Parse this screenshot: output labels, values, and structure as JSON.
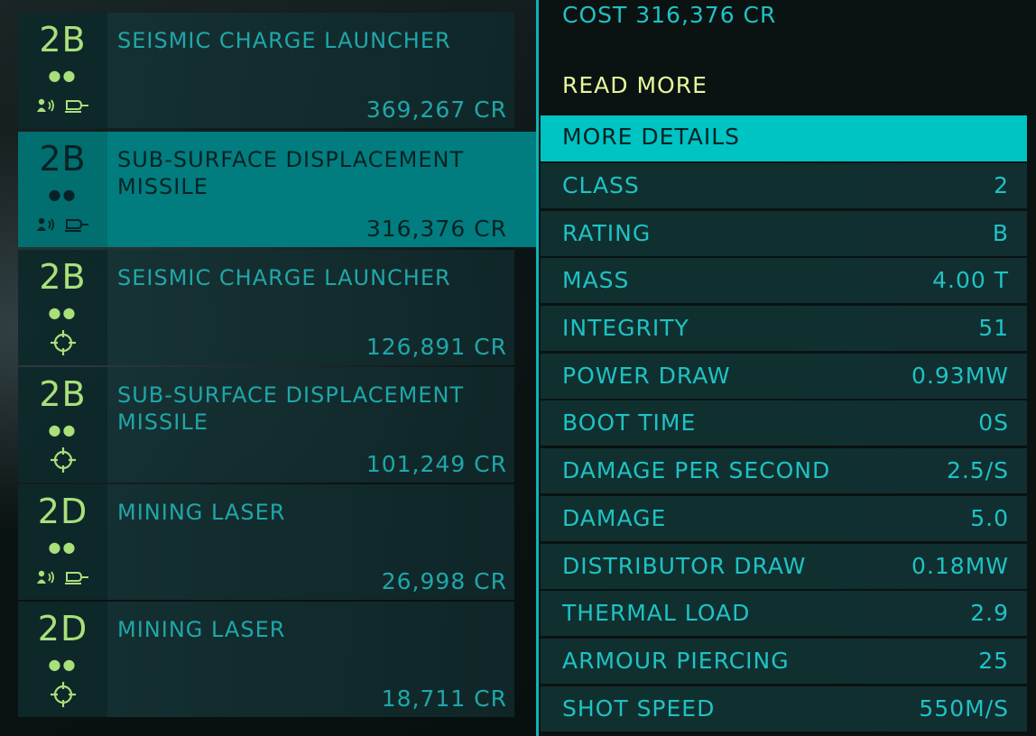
{
  "modules": [
    {
      "grade": "2B",
      "dots": "●●",
      "mount": "turret",
      "name": "SEISMIC CHARGE LAUNCHER",
      "price": "369,267 CR",
      "selected": false
    },
    {
      "grade": "2B",
      "dots": "●●",
      "mount": "turret",
      "name": "SUB-SURFACE DISPLACEMENT MISSILE",
      "price": "316,376 CR",
      "selected": true
    },
    {
      "grade": "2B",
      "dots": "●●",
      "mount": "fixed",
      "name": "SEISMIC CHARGE LAUNCHER",
      "price": "126,891 CR",
      "selected": false
    },
    {
      "grade": "2B",
      "dots": "●●",
      "mount": "fixed",
      "name": "SUB-SURFACE DISPLACEMENT MISSILE",
      "price": "101,249 CR",
      "selected": false
    },
    {
      "grade": "2D",
      "dots": "●●",
      "mount": "turret",
      "name": "MINING LASER",
      "price": "26,998 CR",
      "selected": false
    },
    {
      "grade": "2D",
      "dots": "●●",
      "mount": "fixed",
      "name": "MINING LASER",
      "price": "18,711 CR",
      "selected": false
    }
  ],
  "details": {
    "cost": "COST 316,376 CR",
    "read_more": "READ MORE",
    "header": "MORE DETAILS",
    "stats": [
      {
        "label": "CLASS",
        "value": "2"
      },
      {
        "label": "RATING",
        "value": "B"
      },
      {
        "label": "MASS",
        "value": "4.00 T"
      },
      {
        "label": "INTEGRITY",
        "value": "51"
      },
      {
        "label": "POWER DRAW",
        "value": "0.93MW"
      },
      {
        "label": "BOOT TIME",
        "value": "0S"
      },
      {
        "label": "DAMAGE PER SECOND",
        "value": "2.5/S"
      },
      {
        "label": "DAMAGE",
        "value": "5.0"
      },
      {
        "label": "DISTRIBUTOR DRAW",
        "value": "0.18MW"
      },
      {
        "label": "THERMAL LOAD",
        "value": "2.9"
      },
      {
        "label": "ARMOUR PIERCING",
        "value": "25"
      },
      {
        "label": "SHOT SPEED",
        "value": "550M/S"
      }
    ]
  },
  "colors": {
    "accent": "#00c3c3",
    "text": "#1fc2c4",
    "grade": "#a9e07a",
    "highlight": "#e7f79d",
    "selected_bg": "#017d7f"
  }
}
